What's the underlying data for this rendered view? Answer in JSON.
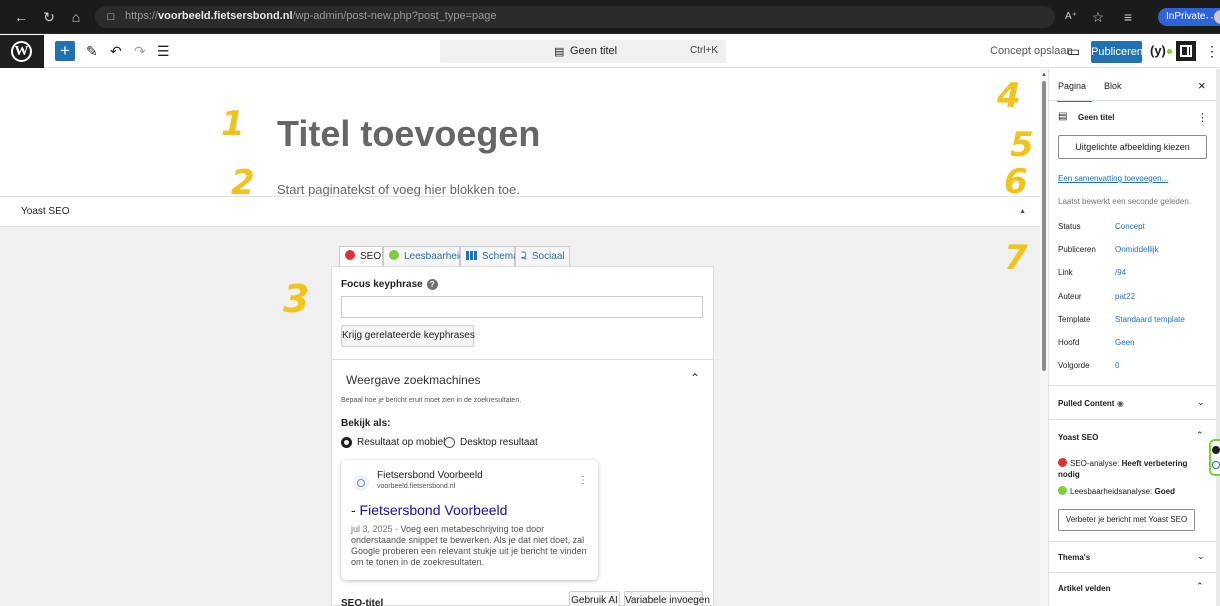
{
  "browser": {
    "url_prefix": "https://",
    "url_domain": "voorbeeld.fietsersbond.nl",
    "url_path": "/wp-admin/post-new.php?post_type=page",
    "inprivate_label": "InPrivate",
    "icons": [
      "back-icon",
      "refresh-icon",
      "home-icon",
      "lock-icon",
      "read-aloud-icon",
      "favorite-icon",
      "favorites-list-icon",
      "more-icon"
    ]
  },
  "toolbar": {
    "logo": "W",
    "add_icon": "+",
    "command_title": "Geen titel",
    "command_shortcut": "Ctrl+K",
    "save_draft": "Concept opslaan",
    "publish": "Publiceren",
    "yoast_logo": "(y)",
    "kebab": "⋮"
  },
  "editor": {
    "title_placeholder": "Titel toevoegen",
    "body_placeholder": "Start paginatekst of voeg hier blokken toe."
  },
  "annotations": [
    "1",
    "2",
    "3",
    "4",
    "5",
    "6",
    "7"
  ],
  "yoast": {
    "metabox_title": "Yoast SEO",
    "tabs": [
      "SEO",
      "Leesbaarheid",
      "Schema",
      "Sociaal"
    ],
    "focus_keyphrase_label": "Focus keyphrase",
    "focus_keyphrase_help": "?",
    "focus_keyphrase_value": "",
    "related_keyphrases_button": "Krijg gerelateerde keyphrases",
    "search_appearance_title": "Weergave zoekmachines",
    "search_appearance_help": "Bepaal hoe je bericht eruit moet zien in de zoekresultaten.",
    "preview_as_label": "Bekijk als:",
    "preview_options": [
      "Resultaat op mobiel",
      "Desktop resultaat"
    ],
    "preview_selected": "Resultaat op mobiel",
    "snippet": {
      "site_name": "Fietsersbond Voorbeeld",
      "site_url": "voorbeeld.fietsersbond.nl",
      "title": "- Fietsersbond Voorbeeld",
      "date": "jul 3, 2025",
      "description": "Voeg een metabeschrijving toe door onderstaande snippet te bewerken. Als je dat niet doet, zal Google proberen een relevant stukje uit je bericht te vinden om te tonen in de zoekresultaten."
    },
    "seo_title_label": "SEO-titel",
    "use_ai_button": "Gebruik AI",
    "insert_variable_button": "Variabele invoegen"
  },
  "sidebar": {
    "tabs": [
      "Pagina",
      "Blok"
    ],
    "active_tab": "Pagina",
    "close": "×",
    "page_title": "Geen titel",
    "featured_image_button": "Uitgelichte afbeelding kiezen",
    "excerpt_link": "Een samenvatting toevoegen...",
    "last_edited": "Laatst bewerkt een seconde geleden.",
    "fields": [
      {
        "key": "Status",
        "value": "Concept"
      },
      {
        "key": "Publiceren",
        "value": "Onmiddellijk"
      },
      {
        "key": "Link",
        "value": "/94"
      },
      {
        "key": "Auteur",
        "value": "pat22"
      },
      {
        "key": "Template",
        "value": "Standaard template"
      },
      {
        "key": "Hoofd",
        "value": "Geen"
      },
      {
        "key": "Volgorde",
        "value": "0"
      }
    ],
    "pulled_content": "Pulled Content",
    "yoast_panel_title": "Yoast SEO",
    "seo_analysis_label": "SEO-analyse:",
    "seo_analysis_value": "Heeft verbetering nodig",
    "readability_label": "Leesbaarheidsanalyse:",
    "readability_value": "Goed",
    "improve_button": "Verbeter je bericht met Yoast SEO",
    "themes": "Thema's",
    "article_fields": "Artikel velden"
  },
  "colors": {
    "accent": "#2271b1",
    "annotation": "#f2c31b",
    "seo_bad": "#dc3232",
    "readability_good": "#7ad03a"
  }
}
